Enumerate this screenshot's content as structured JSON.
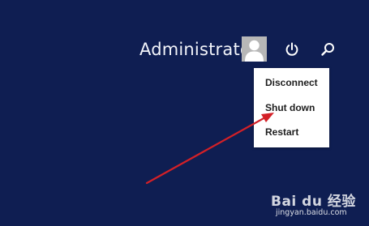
{
  "header": {
    "user_name": "Administrator",
    "icons": {
      "avatar": "user-avatar-icon",
      "power": "power-icon",
      "search": "search-icon"
    }
  },
  "power_menu": {
    "items": [
      {
        "label": "Disconnect"
      },
      {
        "label": "Shut down"
      },
      {
        "label": "Restart"
      }
    ]
  },
  "annotation": {
    "color": "#d32027",
    "points_to": "Shut down"
  },
  "watermark": {
    "logo_text": "Bai du 经验",
    "url": "jingyan.baidu.com"
  },
  "colors": {
    "background": "#0f1e52",
    "menu_background": "#ffffff",
    "text_light": "#f2f4fa",
    "arrow": "#d32027"
  }
}
